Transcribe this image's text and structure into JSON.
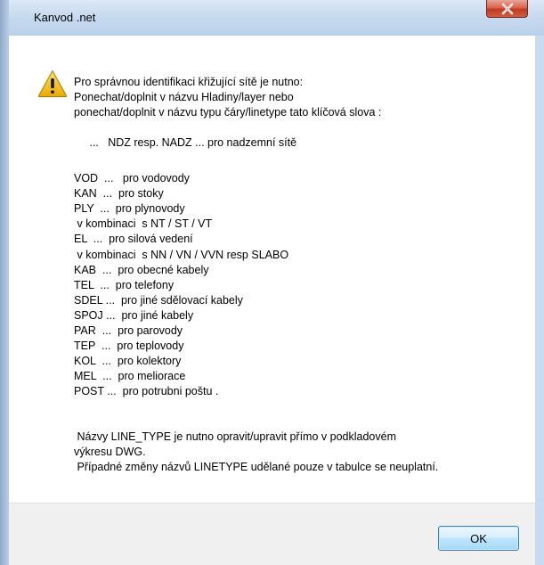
{
  "window": {
    "title": "Kanvod .net"
  },
  "message": {
    "intro_lines": [
      "Pro správnou identifikaci křižující sítě je nutno:",
      "Ponechat/doplnit v názvu Hladiny/layer nebo",
      "ponechat/doplnit v názvu typu čáry/linetype tato klíčová slova :"
    ],
    "overhead_line": "     ...   NDZ resp. NADZ ... pro nadzemní sítě",
    "keyword_lines": [
      "VOD  ...   pro vodovody",
      "KAN  ...  pro stoky",
      "PLY  ...  pro plynovody",
      " v kombinaci  s NT / ST / VT",
      "EL  ...  pro silová vedení",
      " v kombinaci  s NN / VN / VVN resp SLABO",
      "KAB  ...  pro obecné kabely",
      "TEL  ...  pro telefony",
      "SDEL ...  pro jiné sdělovací kabely",
      "SPOJ ...  pro jiné kabely",
      "PAR  ...  pro parovody",
      "TEP  ...  pro teplovody",
      "KOL  ...  pro kolektory",
      "MEL  ...  pro meliorace",
      "POST ...  pro potrubni poštu ."
    ],
    "note_lines": [
      " Názvy LINE_TYPE je nutno opravit/upravit přímo v podkladovém",
      "výkresu DWG.",
      " Případné změny názvů LINETYPE udělané pouze v tabulce se neuplatní."
    ]
  },
  "buttons": {
    "ok_label": "OK"
  },
  "icons": {
    "warning": "warning-triangle-icon",
    "close": "close-icon"
  },
  "colors": {
    "close_button": "#c2391f",
    "warning_fill": "#f5c518"
  }
}
